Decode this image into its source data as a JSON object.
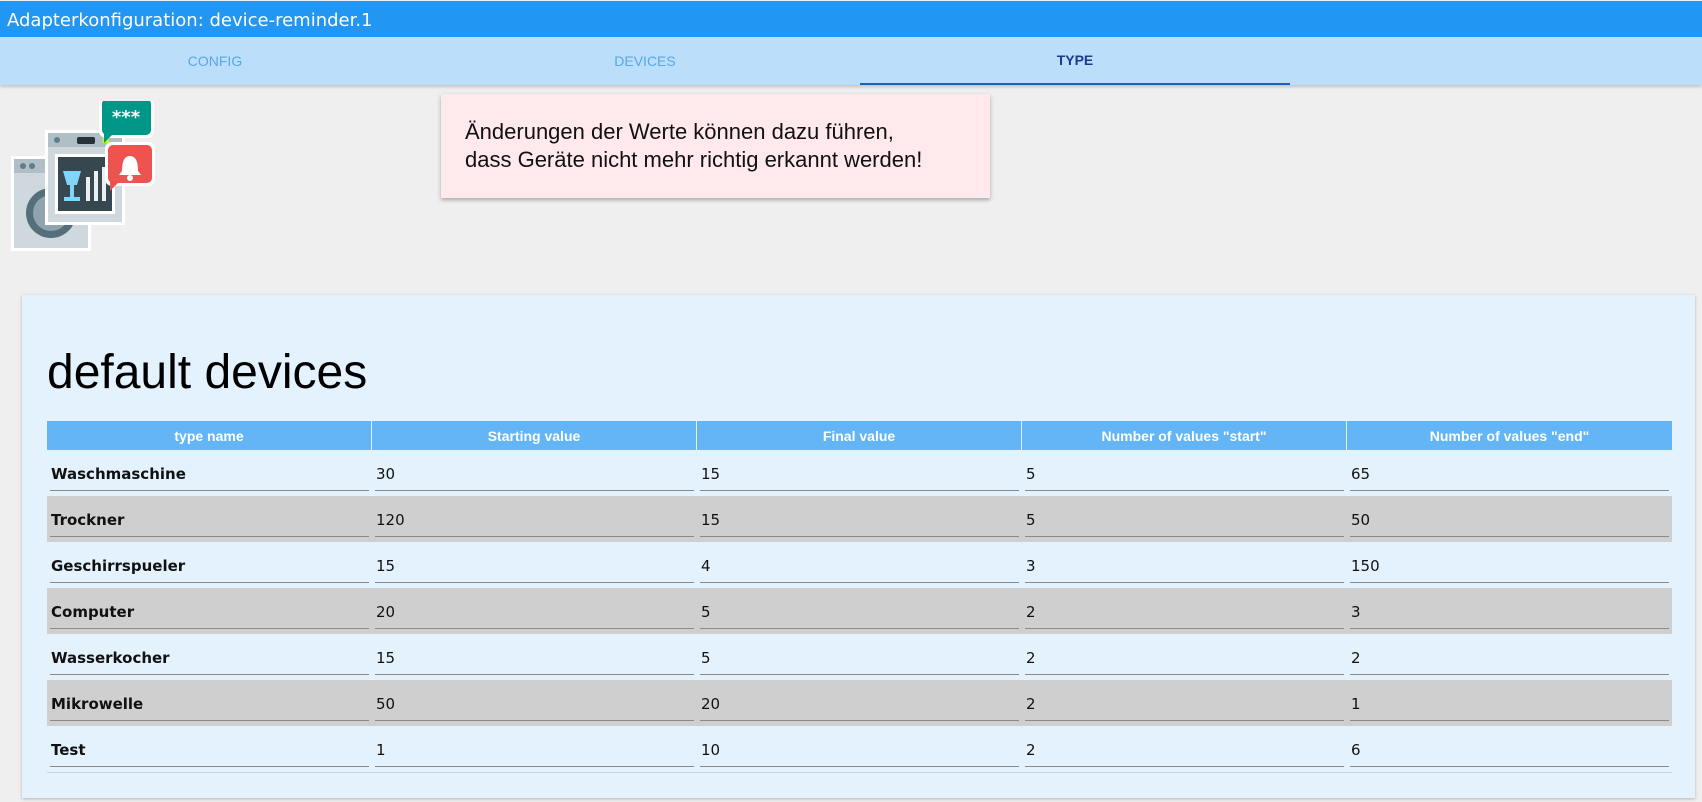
{
  "window": {
    "title": "Adapterkonfiguration: device-reminder.1"
  },
  "tabs": [
    {
      "label": "CONFIG",
      "active": false
    },
    {
      "label": "DEVICES",
      "active": false
    },
    {
      "label": "TYPE",
      "active": true
    }
  ],
  "logo": {
    "icon": "appliance-notification-logo"
  },
  "notice": {
    "line1": "Änderungen der Werte können dazu führen,",
    "line2": "dass Geräte nicht mehr richtig erkannt werden!"
  },
  "section": {
    "title": "default devices",
    "columns": [
      "type name",
      "Starting value",
      "Final value",
      "Number of values \"start\"",
      "Number of values \"end\""
    ],
    "rows": [
      [
        "Waschmaschine",
        "30",
        "15",
        "5",
        "65"
      ],
      [
        "Trockner",
        "120",
        "15",
        "5",
        "50"
      ],
      [
        "Geschirrspueler",
        "15",
        "4",
        "3",
        "150"
      ],
      [
        "Computer",
        "20",
        "5",
        "2",
        "3"
      ],
      [
        "Wasserkocher",
        "15",
        "5",
        "2",
        "2"
      ],
      [
        "Mikrowelle",
        "50",
        "20",
        "2",
        "1"
      ],
      [
        "Test",
        "1",
        "10",
        "2",
        "6"
      ]
    ]
  },
  "colors": {
    "title_bar": "#2196f3",
    "tab_bar": "#bbdefb",
    "table_header": "#64b5f6",
    "card": "#e3f2fd",
    "alt_row": "#cfcfcf",
    "notice": "#ffe9ec"
  }
}
